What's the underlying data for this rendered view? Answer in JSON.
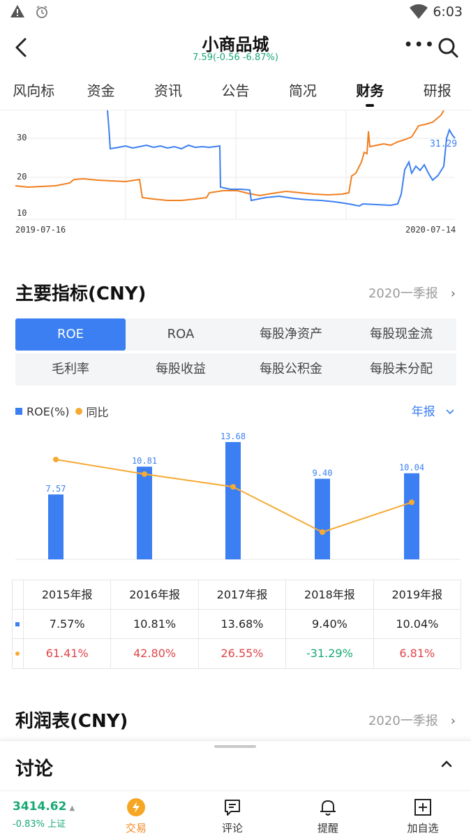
{
  "status": {
    "time": "6:03"
  },
  "header": {
    "title": "小商品城",
    "quote": "7.59(-0.56 -6.87%)"
  },
  "tabs": [
    "风向标",
    "资金",
    "资讯",
    "公告",
    "简况",
    "财务",
    "研报"
  ],
  "active_tab": "财务",
  "price_chart": {
    "y_ticks": [
      "30",
      "20",
      "10"
    ],
    "start_date": "2019-07-16",
    "end_date": "2020-07-14",
    "last_value_label": "31.29",
    "colors": {
      "blue": "#3b7ff2",
      "orange": "#f07f1f"
    }
  },
  "main_indicators": {
    "title": "主要指标(CNY)",
    "period": "2020一季报",
    "buttons": [
      "ROE",
      "ROA",
      "每股净资产",
      "每股现金流",
      "毛利率",
      "每股收益",
      "每股公积金",
      "每股未分配"
    ],
    "active_button": "ROE",
    "legend": {
      "bar": "ROE(%)",
      "line": "同比"
    },
    "period_select": "年报"
  },
  "chart_data": {
    "type": "bar",
    "categories": [
      "2015年报",
      "2016年报",
      "2017年报",
      "2018年报",
      "2019年报"
    ],
    "series": [
      {
        "name": "ROE(%)",
        "type": "bar",
        "values": [
          7.57,
          10.81,
          13.68,
          9.4,
          10.04
        ],
        "labels": [
          "7.57",
          "10.81",
          "13.68",
          "9.40",
          "10.04"
        ],
        "color": "#3b7ff2"
      },
      {
        "name": "同比",
        "type": "line",
        "values": [
          61.41,
          42.8,
          26.55,
          -31.29,
          6.81
        ],
        "color": "#f7a933"
      }
    ]
  },
  "table": {
    "headers": [
      "2015年报",
      "2016年报",
      "2017年报",
      "2018年报",
      "2019年报"
    ],
    "roe": [
      "7.57%",
      "10.81%",
      "13.68%",
      "9.40%",
      "10.04%"
    ],
    "yoy": [
      "61.41%",
      "42.80%",
      "26.55%",
      "-31.29%",
      "6.81%"
    ]
  },
  "income": {
    "title": "利润表(CNY)",
    "period": "2020一季报"
  },
  "discussion": {
    "title": "讨论"
  },
  "bottom": {
    "index_value": "3414.62",
    "index_change": "-0.83% 上证",
    "nav": [
      "交易",
      "评论",
      "提醒",
      "加自选"
    ]
  }
}
